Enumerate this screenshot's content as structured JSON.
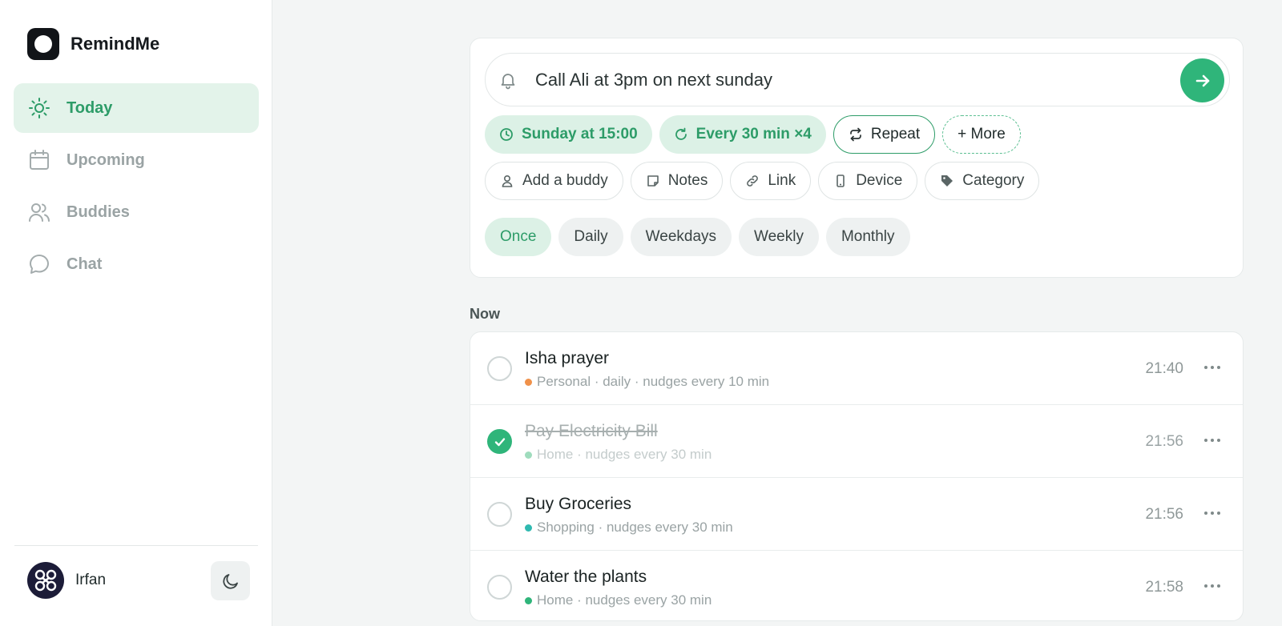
{
  "app": {
    "name": "RemindMe"
  },
  "sidebar": {
    "items": [
      {
        "label": "Today",
        "icon": "sun-icon",
        "active": true
      },
      {
        "label": "Upcoming",
        "icon": "calendar-icon",
        "active": false
      },
      {
        "label": "Buddies",
        "icon": "users-icon",
        "active": false
      },
      {
        "label": "Chat",
        "icon": "chat-bubble-icon",
        "active": false
      }
    ],
    "user": {
      "name": "Irfan"
    },
    "theme_icon": "moon-icon"
  },
  "composer": {
    "input_value": "Call Ali at 3pm on next sunday",
    "chips": {
      "time": "Sunday at 15:00",
      "nudge": "Every 30 min ×4",
      "repeat": "Repeat",
      "more": "+ More"
    },
    "options": {
      "buddy": "Add a buddy",
      "notes": "Notes",
      "link": "Link",
      "device": "Device",
      "category": "Category"
    },
    "frequencies": [
      "Once",
      "Daily",
      "Weekdays",
      "Weekly",
      "Monthly"
    ],
    "selected_frequency": "Once"
  },
  "section": {
    "label": "Now"
  },
  "reminders": [
    {
      "title": "Isha prayer",
      "meta": "Personal · daily · nudges every 10 min",
      "category_color": "#f0914a",
      "time": "21:40",
      "done": false
    },
    {
      "title": "Pay Electricity Bill",
      "meta": "Home · nudges every 30 min",
      "category_color": "#9fdcbd",
      "time": "21:56",
      "done": true
    },
    {
      "title": "Buy Groceries",
      "meta": "Shopping · nudges every 30 min",
      "category_color": "#2fb9b0",
      "time": "21:56",
      "done": false
    },
    {
      "title": "Water the plants",
      "meta": "Home · nudges every 30 min",
      "category_color": "#2fb57a",
      "time": "21:58",
      "done": false
    }
  ],
  "colors": {
    "accent": "#2fb57a",
    "accent_text": "#2d9c68",
    "active_bg": "#e3f3ea"
  }
}
